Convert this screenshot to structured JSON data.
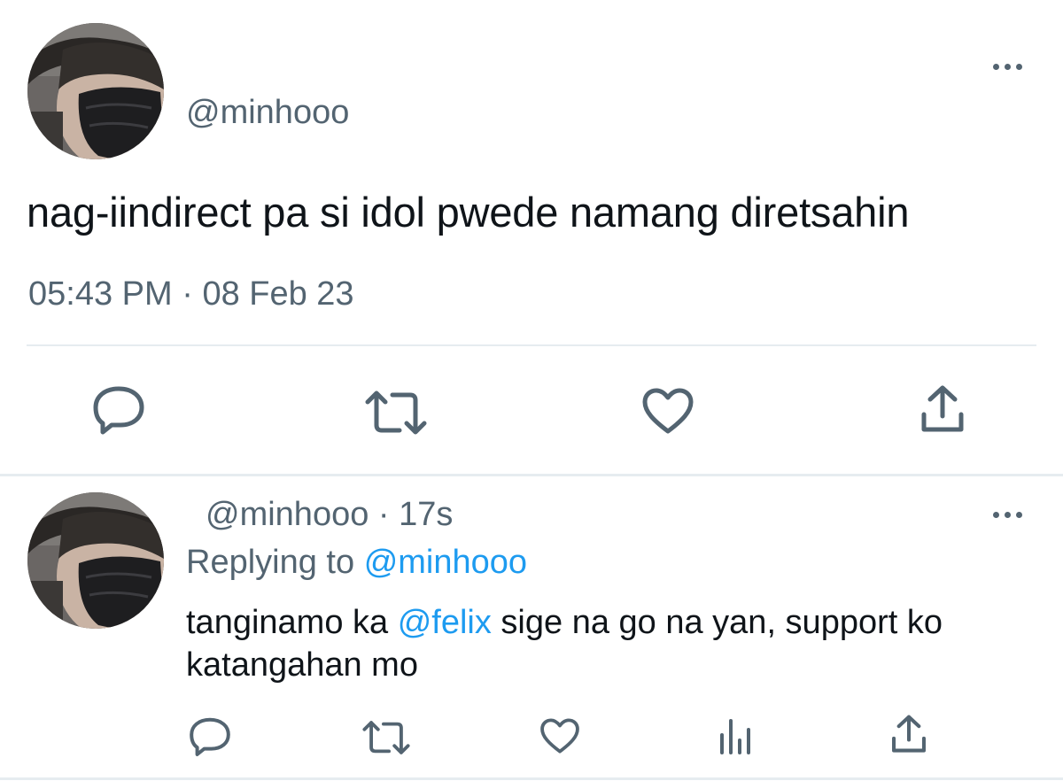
{
  "main_tweet": {
    "handle": "@minhooo",
    "text": "nag-iindirect pa si idol pwede namang diretsahin",
    "time": "05:43 PM",
    "separator": "·",
    "date": "08 Feb 23",
    "avatar_icon": "profile-photo-masked-person",
    "actions": [
      "reply-icon",
      "retweet-icon",
      "like-icon",
      "share-icon"
    ]
  },
  "reply_tweet": {
    "handle": "@minhooo",
    "separator": "·",
    "age": "17s",
    "replying_prefix": "Replying to",
    "replying_mention": "@minhooo",
    "text_before": "tanginamo ka ",
    "text_mention": "@felix",
    "text_after": " sige na go na yan, support ko katangahan mo",
    "avatar_icon": "profile-photo-masked-person",
    "actions": [
      "reply-icon",
      "retweet-icon",
      "like-icon",
      "analytics-icon",
      "share-icon"
    ]
  },
  "colors": {
    "text_primary": "#0f1419",
    "text_secondary": "#536471",
    "link": "#1d9bf0",
    "divider": "#e6ecf0"
  }
}
